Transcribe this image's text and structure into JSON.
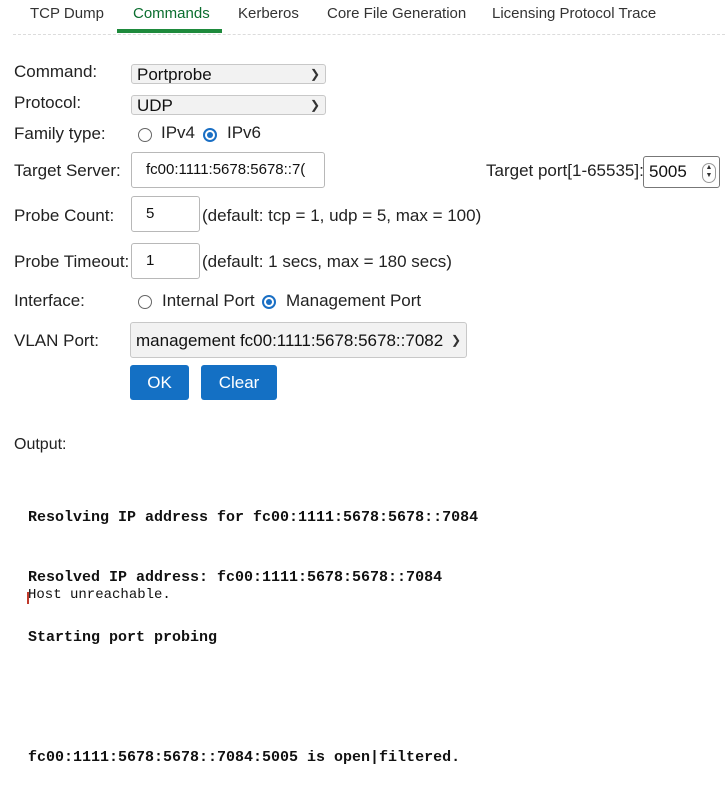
{
  "tabs": [
    {
      "label": "TCP Dump"
    },
    {
      "label": "Commands"
    },
    {
      "label": "Kerberos"
    },
    {
      "label": "Core File Generation"
    },
    {
      "label": "Licensing Protocol Trace"
    }
  ],
  "active_tab": "Commands",
  "form": {
    "command_label": "Command:",
    "command_value": "Portprobe",
    "protocol_label": "Protocol:",
    "protocol_value": "UDP",
    "family_label": "Family type:",
    "family_options": [
      "IPv4",
      "IPv6"
    ],
    "family_selected": "IPv6",
    "target_server_label": "Target Server:",
    "target_server_value": "fc00:1111:5678:5678::7(",
    "target_port_label": "Target port[1-65535]:",
    "target_port_value": "5005",
    "probe_count_label": "Probe Count:",
    "probe_count_value": "5",
    "probe_count_hint": "(default: tcp = 1, udp = 5, max = 100)",
    "probe_timeout_label": "Probe Timeout:",
    "probe_timeout_value": "1",
    "probe_timeout_hint": "(default: 1 secs, max = 180 secs)",
    "interface_label": "Interface:",
    "interface_options": [
      "Internal Port",
      "Management Port"
    ],
    "interface_selected": "Management Port",
    "vlan_label": "VLAN Port:",
    "vlan_value": "management fc00:1111:5678:5678::7082",
    "ok_label": "OK",
    "clear_label": "Clear"
  },
  "output": {
    "label": "Output:",
    "lines": [
      "Resolving IP address for fc00:1111:5678:5678::7084",
      "Resolved IP address: fc00:1111:5678:5678::7084",
      "Starting port probing",
      "",
      "fc00:1111:5678:5678::7084:5005 is open|filtered."
    ],
    "error_line": "Host unreachable."
  },
  "colors": {
    "accent_green": "#1e8a3c",
    "button_blue": "#1470c4",
    "radio_blue": "#1a6fc4"
  }
}
